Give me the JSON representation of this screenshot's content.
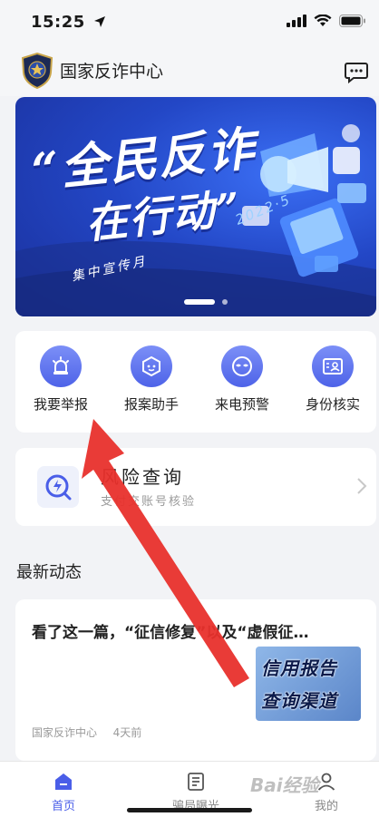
{
  "status_bar": {
    "time": "15:25"
  },
  "header": {
    "title": "国家反诈中心"
  },
  "banner": {
    "line1": "“全民反诈",
    "line2": "在行动”",
    "subtitle": "集中宣传月",
    "year": "2022·5",
    "page_count": 2,
    "active_page": 1
  },
  "quick_actions": [
    {
      "label": "我要举报",
      "icon": "alarm-icon"
    },
    {
      "label": "报案助手",
      "icon": "assistant-icon"
    },
    {
      "label": "来电预警",
      "icon": "mask-icon"
    },
    {
      "label": "身份核实",
      "icon": "id-card-icon"
    }
  ],
  "risk": {
    "title": "风险查询",
    "subtitle": "支付交账号核验"
  },
  "section": {
    "title": "最新动态"
  },
  "news": [
    {
      "title": "看了这一篇，“征信修复”以及“虚假征…",
      "source": "国家反诈中心",
      "time": "4天前",
      "thumb_line1": "信用报告",
      "thumb_line2": "查询渠道"
    }
  ],
  "tabbar": {
    "items": [
      {
        "label": "首页",
        "icon": "home-icon",
        "active": true
      },
      {
        "label": "骗局曝光",
        "icon": "exposure-icon",
        "active": false
      },
      {
        "label": "我的",
        "icon": "user-icon",
        "active": false
      }
    ]
  },
  "watermark": "Bai经验",
  "colors": {
    "accent": "#4a5ee8",
    "annotation_arrow": "#e8302c"
  }
}
